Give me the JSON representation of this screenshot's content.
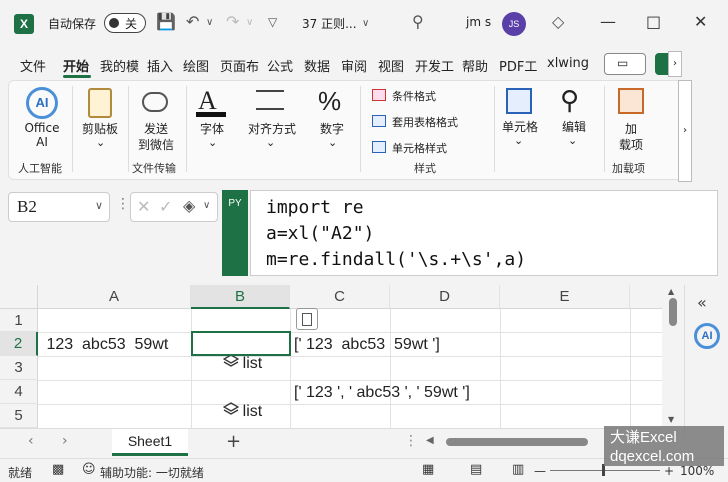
{
  "title_bar": {
    "app_icon": "excel-icon",
    "autosave_label": "自动保存",
    "autosave_state": "关",
    "doc_title": "37 正则...",
    "user_name": "jm s",
    "avatar_initials": "JS"
  },
  "menu": {
    "items": [
      "文件",
      "开始",
      "我的模",
      "插入",
      "绘图",
      "页面布",
      "公式",
      "数据",
      "审阅",
      "视图",
      "开发工",
      "帮助",
      "PDF工",
      "xlwing"
    ],
    "active": "开始"
  },
  "ribbon": {
    "office_ai": "Office AI",
    "office_ai_group": "人工智能",
    "clipboard": "剪贴板",
    "send_wechat_1": "发送",
    "send_wechat_2": "到微信",
    "file_transfer_group": "文件传输",
    "font": "字体",
    "align": "对齐方式",
    "number": "数字",
    "cond_format": "条件格式",
    "table_format": "套用表格格式",
    "cell_style": "单元格样式",
    "styles_group": "样式",
    "cells": "单元格",
    "edit": "编辑",
    "addin_1": "加",
    "addin_2": "载项",
    "addin_group": "加载项"
  },
  "formula_bar": {
    "name_box": "B2",
    "py_tag": "PY",
    "code_lines": [
      "import re",
      "a=xl(\"A2\")",
      "m=re.findall('\\s.+\\s',a)"
    ]
  },
  "grid": {
    "columns": [
      "A",
      "B",
      "C",
      "D",
      "E"
    ],
    "rows": [
      "1",
      "2",
      "3",
      "4",
      "5"
    ],
    "a2": " 123  abc53  59wt ",
    "b2": "list",
    "c2": "[' 123  abc53  59wt ']",
    "b4": "list",
    "c4": "[' 123 ', ' abc53 ', ' 59wt ']"
  },
  "sheet_tabs": {
    "active": "Sheet1",
    "add": "+"
  },
  "status_bar": {
    "ready": "就绪",
    "accessibility": "辅助功能: 一切就绪",
    "zoom": "100%"
  },
  "watermark": {
    "line1": "大谦Excel",
    "line2": "dqexcel.com"
  },
  "colors": {
    "accent": "#1e7145"
  }
}
